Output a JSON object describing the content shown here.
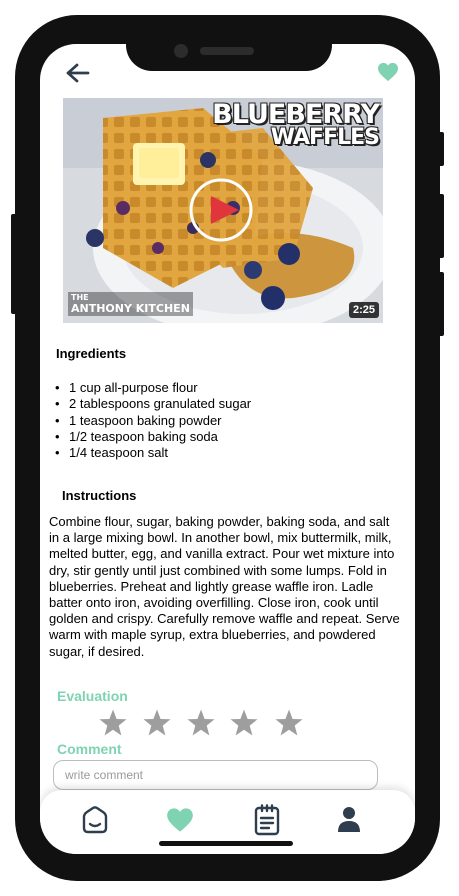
{
  "header": {
    "back_icon": "arrow-left-icon",
    "favorite_icon": "heart-icon",
    "accent_color": "#7fd3b2"
  },
  "video": {
    "title_line1": "BLUEBERRY",
    "title_line2": "WAFFLES",
    "brand_small": "THE",
    "brand_name": "ANTHONY KITCHEN",
    "duration": "2:25",
    "play_icon": "play-icon",
    "play_color": "#e0353c"
  },
  "ingredients": {
    "heading": "Ingredients",
    "items": [
      "1 cup all-purpose flour",
      "2 tablespoons granulated sugar",
      "1 teaspoon baking powder",
      "1/2 teaspoon baking soda",
      "1/4 teaspoon salt"
    ]
  },
  "instructions": {
    "heading": "Instructions",
    "text": "Combine flour, sugar, baking powder, baking soda, and salt in a large mixing bowl. In another bowl, mix buttermilk, milk, melted butter, egg, and vanilla extract. Pour wet mixture into dry, stir gently until just combined with some lumps. Fold in blueberries. Preheat and lightly grease waffle iron. Ladle batter onto iron, avoiding overfilling. Close iron, cook until golden and crispy. Carefully remove waffle and repeat. Serve warm with maple syrup, extra blueberries, and powdered sugar, if desired."
  },
  "evaluation": {
    "heading": "Evaluation",
    "max_stars": 5,
    "rating": 0,
    "star_color": "#9e9e9e"
  },
  "comment": {
    "heading": "Comment",
    "placeholder": "write comment",
    "value": ""
  },
  "tabbar": {
    "items": [
      {
        "icon": "home-icon",
        "active": false
      },
      {
        "icon": "heart-icon",
        "active": true
      },
      {
        "icon": "notepad-icon",
        "active": false
      },
      {
        "icon": "user-icon",
        "active": false
      }
    ],
    "active_color": "#7fd3b2",
    "inactive_color": "#2f3e4e"
  }
}
